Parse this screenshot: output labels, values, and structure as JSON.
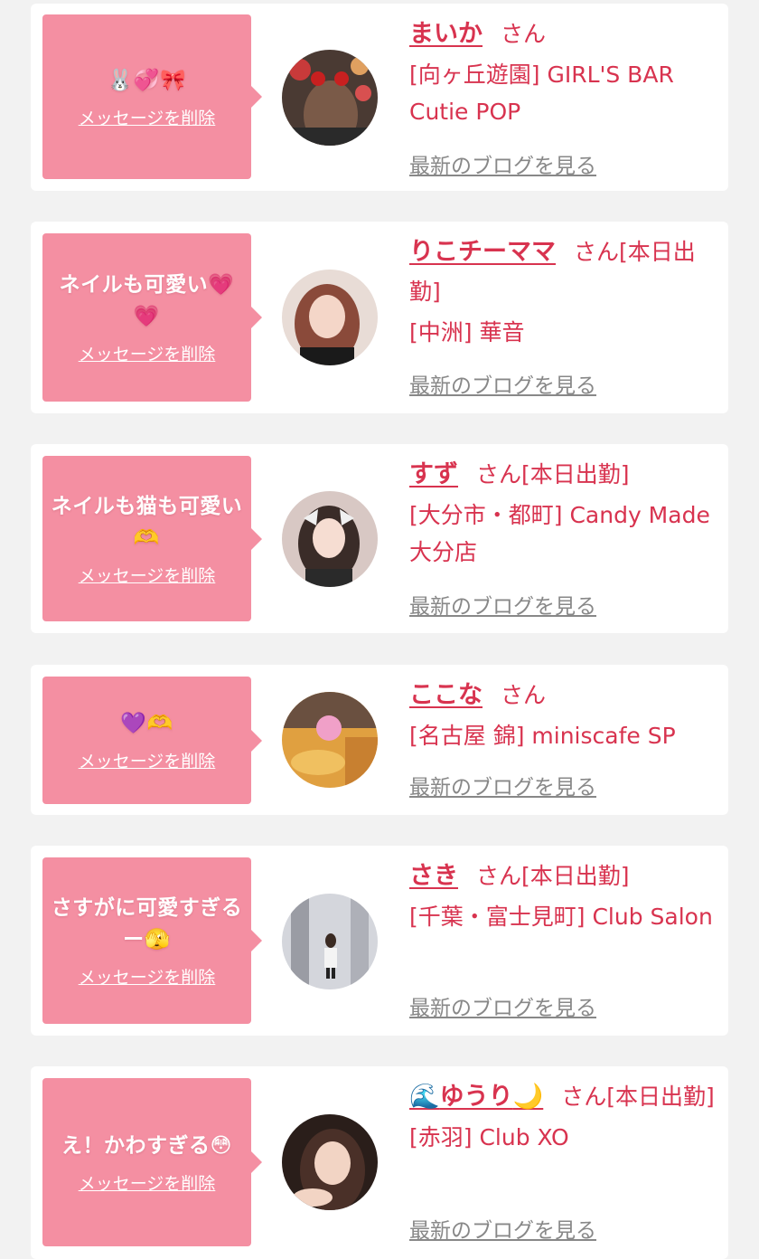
{
  "delete_label": "メッセージを削除",
  "blog_label": "最新のブログを見る",
  "san_suffix": "さん",
  "colors": {
    "accent": "#d8334f",
    "bubble": "#f48fa2",
    "muted": "#888888",
    "background": "#f2f2f2"
  },
  "cards": [
    {
      "message": "🐰💞🎀",
      "name": "まいか",
      "name_prefix_icon": "",
      "name_suffix_icon": "",
      "suffix": "さん",
      "status": "",
      "shop": "[向ヶ丘遊園] GIRL'S BAR Cutie POP",
      "avatar_icon": "person-photo"
    },
    {
      "message": "ネイルも可愛い💗💗",
      "name": "りこチーママ",
      "name_prefix_icon": "",
      "name_suffix_icon": "",
      "suffix": "さん",
      "status": "[本日出勤]",
      "shop": "[中洲] 華音",
      "avatar_icon": "person-photo"
    },
    {
      "message": "ネイルも猫も可愛い🫶",
      "name": "すず",
      "name_prefix_icon": "",
      "name_suffix_icon": "",
      "suffix": "さん",
      "status": "[本日出勤]",
      "shop": "[大分市・都町] Candy Made 大分店",
      "avatar_icon": "person-photo"
    },
    {
      "message": "💜🫶",
      "name": "ここな",
      "name_prefix_icon": "",
      "name_suffix_icon": "",
      "suffix": "さん",
      "status": "",
      "shop": "[名古屋 錦] miniscafe SP",
      "avatar_icon": "person-photo"
    },
    {
      "message": "さすがに可愛すぎるー🫣",
      "name": "さき",
      "name_prefix_icon": "",
      "name_suffix_icon": "",
      "suffix": "さん",
      "status": "[本日出勤]",
      "shop": "[千葉・富士見町] Club Salon",
      "avatar_icon": "person-photo"
    },
    {
      "message": "え！かわすぎる😳",
      "name": "ゆうり",
      "name_prefix_icon": "🌊",
      "name_suffix_icon": "🌙",
      "suffix": "さん",
      "status": "[本日出勤]",
      "shop": "[赤羽] Club XO",
      "avatar_icon": "person-photo"
    }
  ]
}
